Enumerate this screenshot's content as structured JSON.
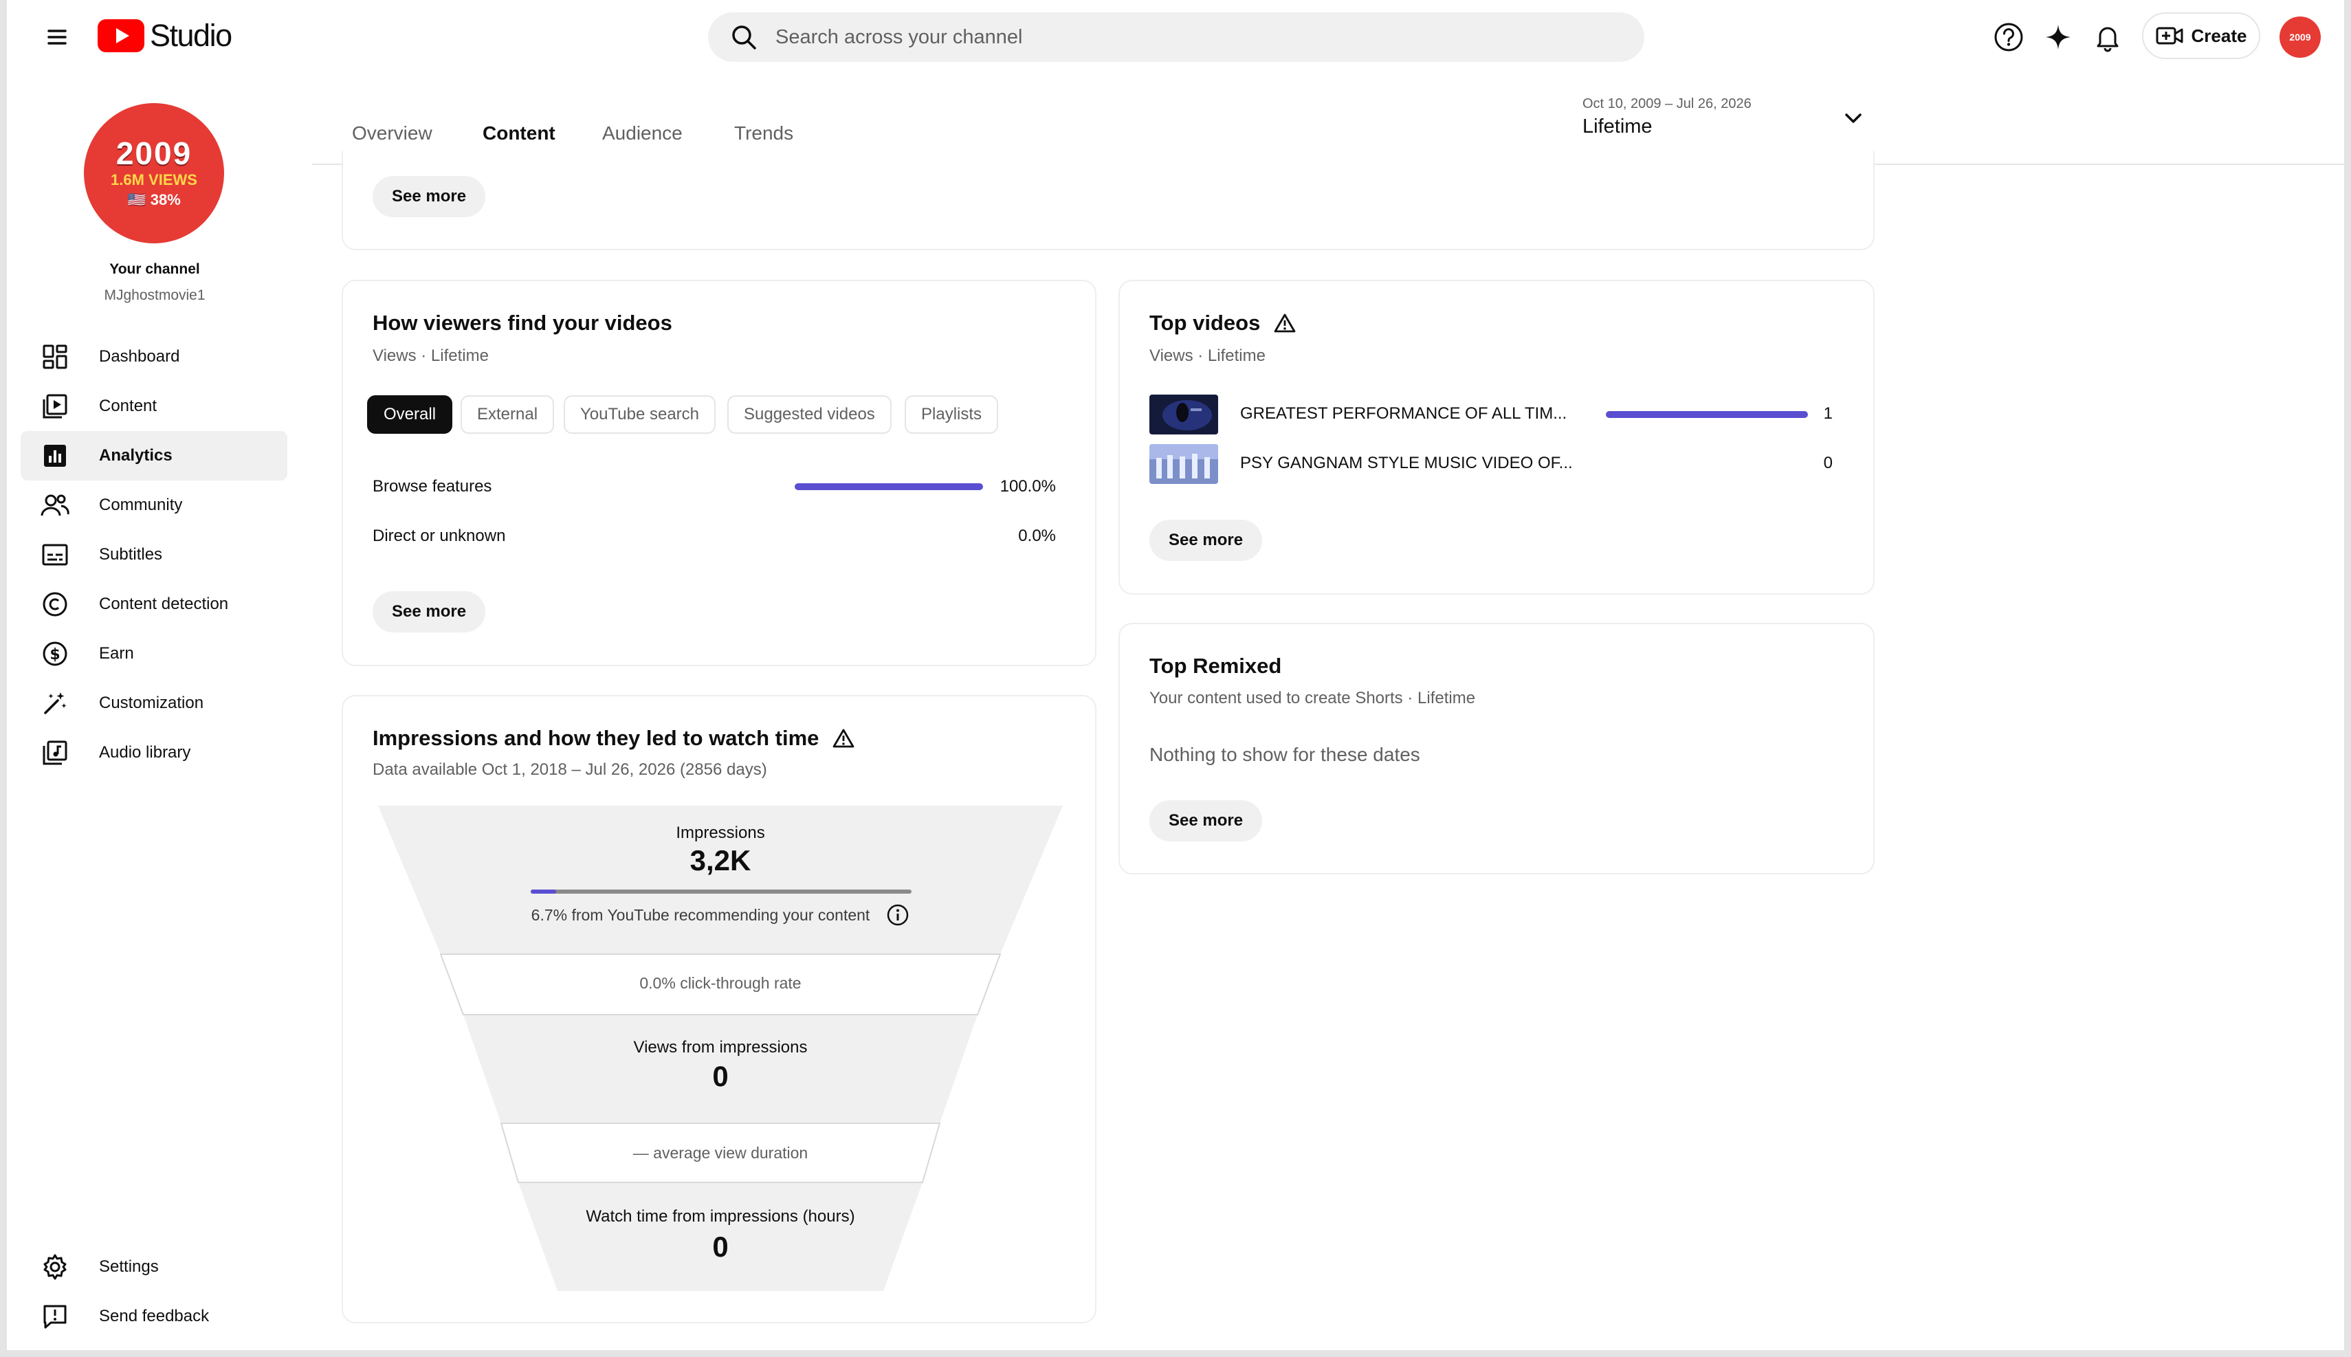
{
  "app": {
    "brand": "Studio"
  },
  "header": {
    "search_placeholder": "Search across your channel",
    "create_label": "Create",
    "avatar_text": "2009"
  },
  "channel": {
    "avatar_year": "2009",
    "avatar_views": "1.6M VIEWS",
    "avatar_pct": "🇺🇸 38%",
    "title": "Your channel",
    "handle": "MJghostmovie1"
  },
  "sidebar": {
    "items": [
      {
        "label": "Dashboard",
        "icon": "dashboard-icon"
      },
      {
        "label": "Content",
        "icon": "content-icon"
      },
      {
        "label": "Analytics",
        "icon": "analytics-icon",
        "active": true
      },
      {
        "label": "Community",
        "icon": "community-icon"
      },
      {
        "label": "Subtitles",
        "icon": "subtitles-icon"
      },
      {
        "label": "Content detection",
        "icon": "copyright-icon"
      },
      {
        "label": "Earn",
        "icon": "dollar-icon"
      },
      {
        "label": "Customization",
        "icon": "magic-wand-icon"
      },
      {
        "label": "Audio library",
        "icon": "audio-library-icon"
      }
    ],
    "bottom": [
      {
        "label": "Settings",
        "icon": "gear-icon"
      },
      {
        "label": "Send feedback",
        "icon": "feedback-icon"
      }
    ]
  },
  "tabs": [
    {
      "label": "Overview"
    },
    {
      "label": "Content",
      "active": true
    },
    {
      "label": "Audience"
    },
    {
      "label": "Trends"
    }
  ],
  "date": {
    "range": "Oct 10, 2009 – Jul 26, 2026",
    "label": "Lifetime"
  },
  "top_card": {
    "see_more": "See more"
  },
  "traffic_card": {
    "title": "How viewers find your videos",
    "subtitle": "Views · Lifetime",
    "chips": [
      "Overall",
      "External",
      "YouTube search",
      "Suggested videos",
      "Playlists"
    ],
    "rows": [
      {
        "label": "Browse features",
        "value": "100.0%",
        "fraction": 1.0
      },
      {
        "label": "Direct or unknown",
        "value": "0.0%",
        "fraction": 0.0
      }
    ],
    "see_more": "See more"
  },
  "top_videos_card": {
    "title": "Top videos",
    "subtitle": "Views · Lifetime",
    "videos": [
      {
        "title": "GREATEST PERFORMANCE OF ALL TIM...",
        "value": "1",
        "fraction": 1.0
      },
      {
        "title": "PSY GANGNAM STYLE MUSIC VIDEO OF...",
        "value": "0",
        "fraction": 0.0
      }
    ],
    "see_more": "See more"
  },
  "remixed_card": {
    "title": "Top Remixed",
    "subtitle": "Your content used to create Shorts · Lifetime",
    "empty": "Nothing to show for these dates",
    "see_more": "See more"
  },
  "funnel_card": {
    "title": "Impressions and how they led to watch time",
    "subtitle": "Data available Oct 1, 2018 – Jul 26, 2026 (2856 days)",
    "impressions_label": "Impressions",
    "impressions_value": "3,2K",
    "recommend_fraction": 0.067,
    "recommend_text": "6.7% from YouTube recommending your content",
    "ctr_text": "0.0% click-through rate",
    "views_label": "Views from impressions",
    "views_value": "0",
    "avd_text": "— average view duration",
    "watch_label": "Watch time from impressions (hours)",
    "watch_value": "0"
  },
  "colors": {
    "accent": "#5b4fd1",
    "brand_red": "#ff0000",
    "avatar_red": "#e63a35"
  }
}
